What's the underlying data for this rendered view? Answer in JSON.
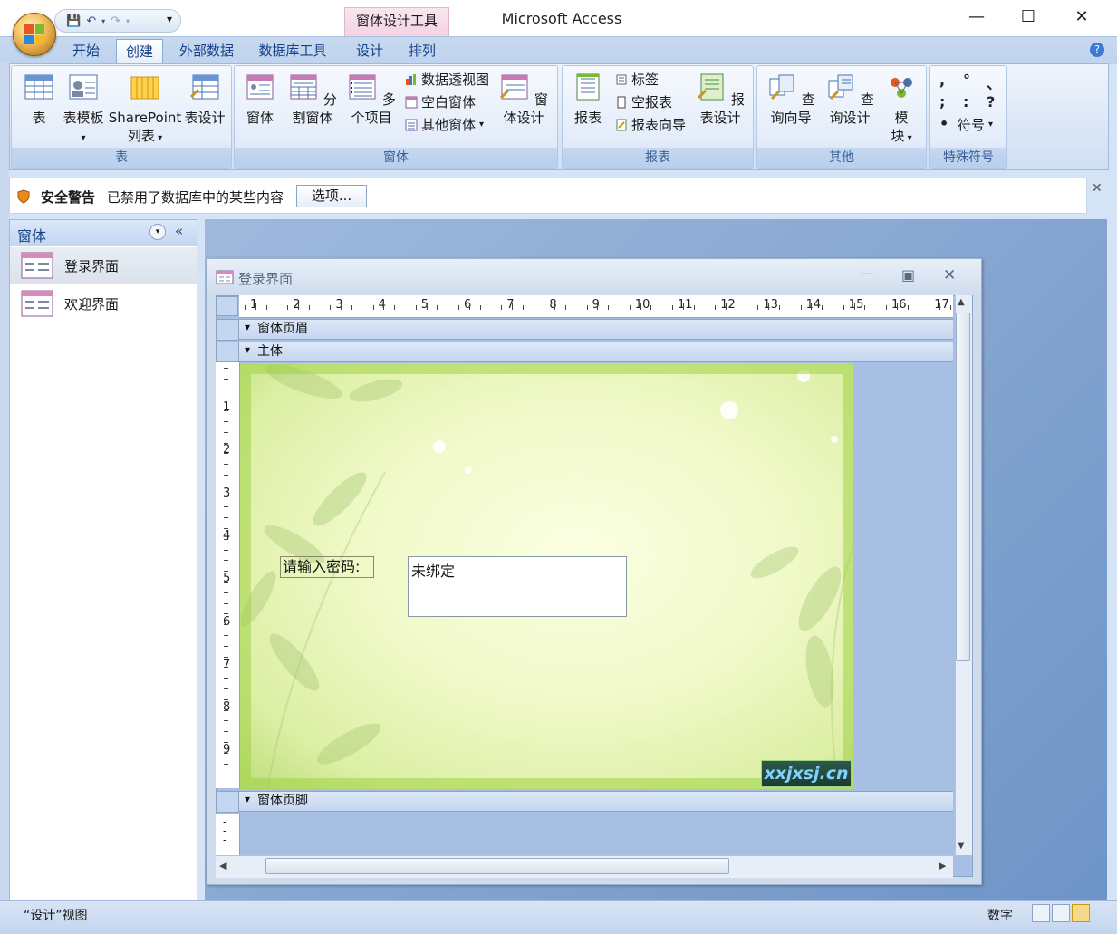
{
  "window": {
    "app_title": "Microsoft Access",
    "context_tab": "窗体设计工具"
  },
  "tabs": [
    {
      "label": "开始",
      "active": false
    },
    {
      "label": "创建",
      "active": true
    },
    {
      "label": "外部数据",
      "active": false
    },
    {
      "label": "数据库工具",
      "active": false
    },
    {
      "label": "设计",
      "active": false
    },
    {
      "label": "排列",
      "active": false
    }
  ],
  "ribbon": {
    "group_table": {
      "label": "表",
      "buttons": [
        "表",
        "表模板",
        "SharePoint",
        "列表",
        "表设计"
      ]
    },
    "group_form": {
      "label": "窗体",
      "big": [
        "窗体",
        "分割窗体",
        "多个项目",
        "窗体设计"
      ],
      "small": [
        "数据透视图",
        "空白窗体",
        "其他窗体"
      ]
    },
    "group_report": {
      "label": "报表",
      "big": [
        "报表",
        "报表设计"
      ],
      "small": [
        "标签",
        "空报表",
        "报表向导"
      ]
    },
    "group_other": {
      "label": "其他",
      "big": [
        "查询向导",
        "查询设计",
        "模",
        "块"
      ]
    },
    "group_symbols": {
      "label": "特殊符号",
      "symbols": [
        ",",
        "°",
        "、",
        ";",
        ":",
        "?",
        "•"
      ],
      "symbol_button": "符号"
    }
  },
  "security": {
    "title": "安全警告",
    "message": "已禁用了数据库中的某些内容",
    "options_button": "选项..."
  },
  "nav": {
    "header": "窗体",
    "items": [
      "登录界面",
      "欢迎界面"
    ]
  },
  "form": {
    "title": "登录界面",
    "sections": {
      "header": "窗体页眉",
      "detail": "主体",
      "footer": "窗体页脚"
    },
    "ruler_h": [
      "1",
      "2",
      "3",
      "4",
      "5",
      "6",
      "7",
      "8",
      "9",
      "10",
      "11",
      "12",
      "13",
      "14",
      "15",
      "16",
      "17"
    ],
    "ruler_v": [
      "1",
      "2",
      "3",
      "4",
      "5",
      "6",
      "7",
      "8",
      "9"
    ],
    "label_text": "请输入密码:",
    "textbox_text": "未绑定",
    "watermark": "xxjxsj.cn"
  },
  "status": {
    "view": "“设计”视图",
    "mode": "数字"
  },
  "colors": {
    "accent": "#15418a",
    "ribbon_bg": "#dbe7f7",
    "workspace": "#7a9fcf"
  }
}
